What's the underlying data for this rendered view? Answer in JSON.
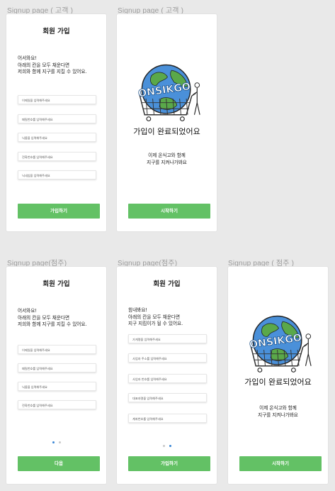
{
  "frames": [
    {
      "label": "Signup page ( 고객 )"
    },
    {
      "label": "Signup page ( 고객 )"
    },
    {
      "label": "Signup page(점주)"
    },
    {
      "label": "Signup page(점주)"
    },
    {
      "label": "Signup page ( 점주 )"
    }
  ],
  "signup_title": "회원 가입",
  "customer_form": {
    "intro": "어서와요!\n아래의 칸을 모두 채운다면\n저희와 함께 지구를 지킬 수 있어요.",
    "fields": [
      "이메일을 입력해주세요",
      "패밀번호를 입력해주세요",
      "닉름을 입력해주세요",
      "전화번호를 입력해주세요",
      "닉네임을 입력해주세요"
    ],
    "button": "가입하기"
  },
  "complete": {
    "logo_text": "ONSIKGO",
    "title": "가입이 완료되었어요",
    "subtitle": "이제 온식고와 함께\n지구를 지켜나가봐요",
    "button": "시작하기"
  },
  "owner_form_1": {
    "intro": "어서와요!\n아래의 칸을 모두 채운다면\n저희와 함께 지구를 지킬 수 있어요.",
    "fields": [
      "이메일을 입력해주세요",
      "패밀번호를 입력해주세요",
      "닉름을 입력해주세요",
      "전화번호를 입력해주세요"
    ],
    "button": "다음",
    "page": 1
  },
  "owner_form_2": {
    "intro": "힘내봐요!\n아래의 칸을 모두 채운다면\n지구 지킴이가 될 수 있어요.",
    "fields": [
      "가게명을 입력해주세요",
      "사업자 주소를 입력해주세요",
      "사업자 번호를 입력해주세요",
      "대표자명을 입력해주세요",
      "계좌번호를 입력해주세요"
    ],
    "button": "가입하기",
    "page": 2
  },
  "colors": {
    "accent": "#63c165",
    "dot_active": "#3a86d6",
    "dot_inactive": "#c9c9c9"
  }
}
